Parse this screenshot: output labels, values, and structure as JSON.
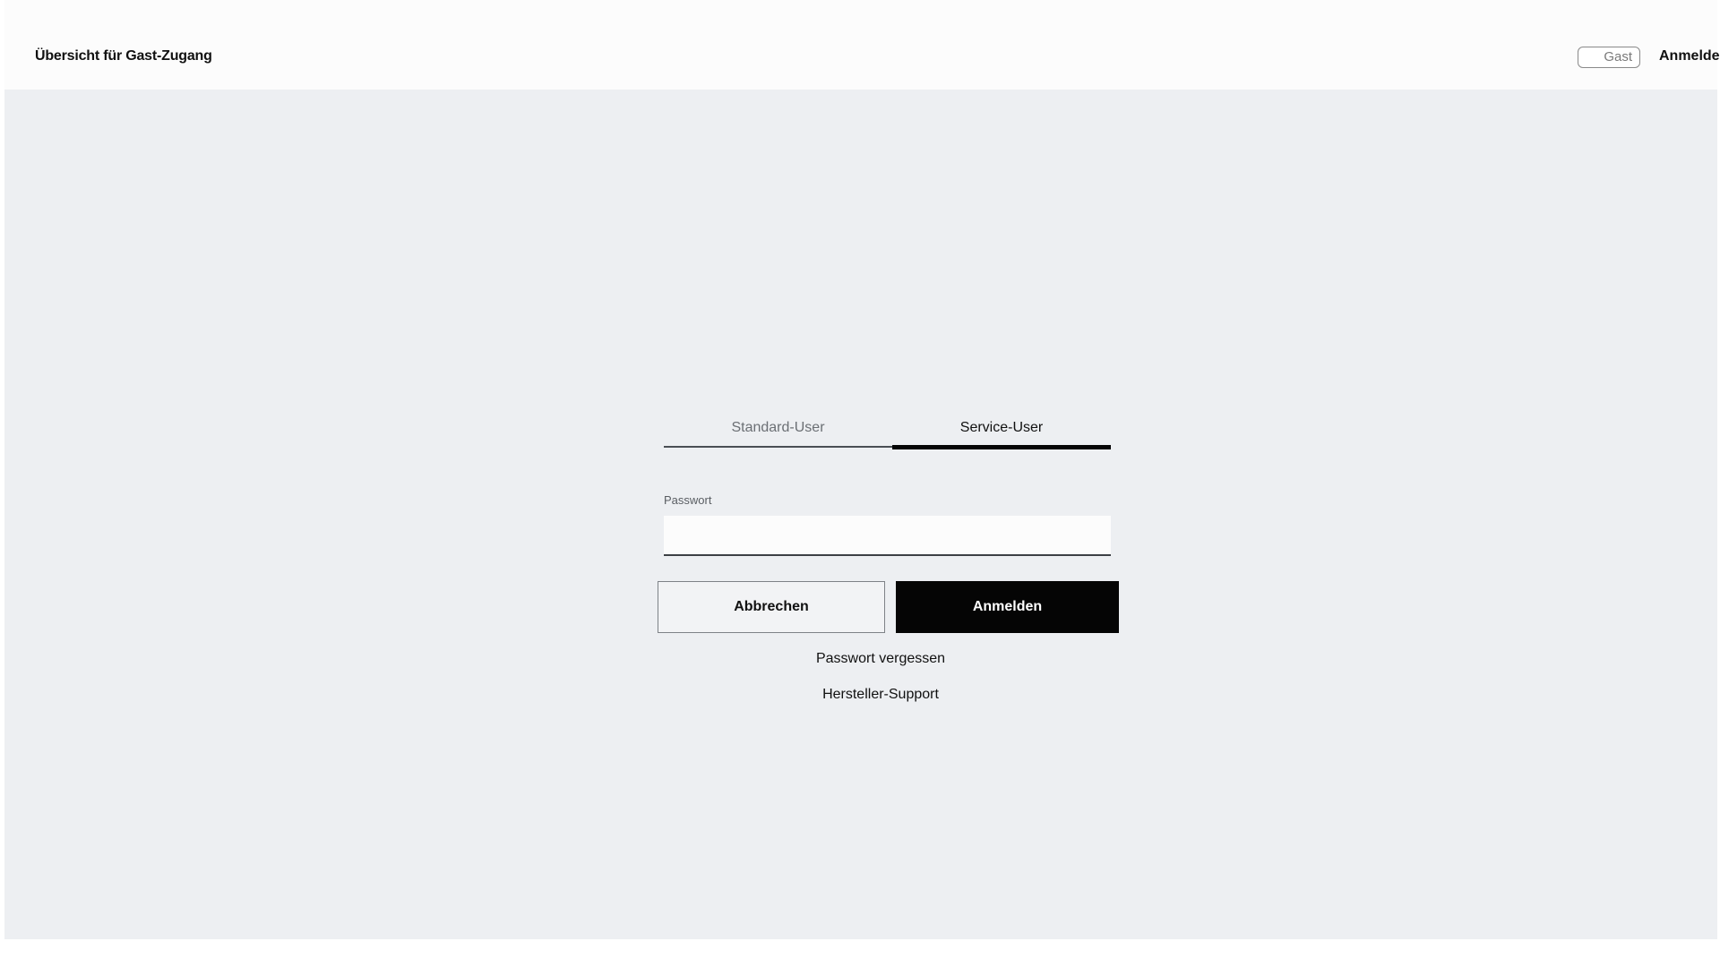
{
  "header": {
    "title": "Übersicht für Gast-Zugang",
    "user_badge": "Gast",
    "login_link": "Anmelden"
  },
  "login": {
    "tabs": [
      {
        "label": "Standard-User",
        "active": false
      },
      {
        "label": "Service-User",
        "active": true
      }
    ],
    "password": {
      "label": "Passwort",
      "value": "",
      "placeholder": ""
    },
    "cancel_label": "Abbrechen",
    "submit_label": "Anmelden",
    "forgot_password_label": "Passwort vergessen",
    "support_label": "Hersteller-Support"
  },
  "colors": {
    "background": "#edeff2",
    "primary_button": "#050505",
    "active_tab_indicator": "#050505"
  }
}
